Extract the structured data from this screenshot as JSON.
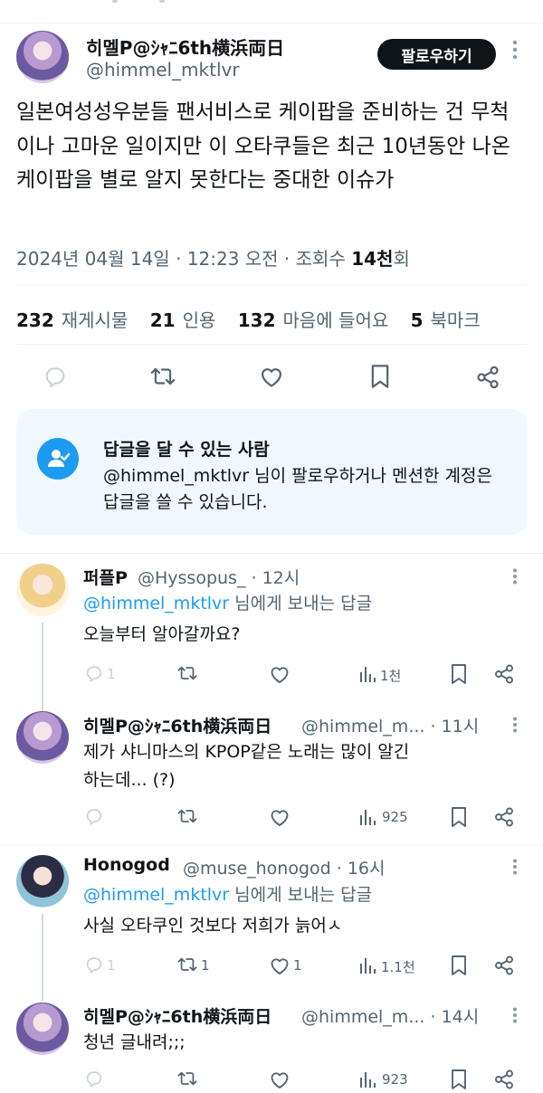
{
  "tweet": {
    "display_name": "히멜P@ｼｬﾆ6th横浜両日",
    "handle": "@himmel_mktlvr",
    "follow_label": "팔로우하기",
    "more_label": "⋮",
    "text": "일본여성성우분들 팬서비스로 케이팝을 준비하는 건 무척이나 고마운 일이지만 이 오타쿠들은 최근 10년동안 나온 케이팝을 별로 알지 못한다는 중대한 이슈가",
    "date": "2024년 04월 14일 · 12:23 오전 · 조회수 ",
    "views_value": "14천",
    "views_suffix": "회",
    "stats": {
      "retweets": "232",
      "retweets_label": "재게시물",
      "quotes": "21",
      "quotes_label": "인용",
      "likes": "132",
      "likes_label": "마음에 들어요",
      "bookmarks": "5",
      "bookmarks_label": "북마크"
    }
  },
  "reply_restriction": {
    "title": "답글을 달 수 있는 사람",
    "description": "@himmel_mktlvr 님이 팔로우하거나 멘션한 계정은 답글을 쓸 수 있습니다."
  },
  "replies": [
    {
      "display_name": "퍼플P",
      "handle_time": "@Hyssopus_ · 12시",
      "replying_mention": "@himmel_mktlvr",
      "replying_suffix": " 님에게 보내는 답글",
      "text": "오늘부터 알아갈까요?",
      "reply_count": "1",
      "retweet_count": "",
      "like_count": "",
      "view_count": "1천"
    },
    {
      "display_name": "히멜P@ｼｬﾆ6th横浜両日",
      "handle_time": "@himmel_m... · 11시",
      "text_line1": "제가 샤니마스의 KPOP같은 노래는 많이 알긴",
      "text_line2": "하는데... (?)",
      "reply_count": "",
      "retweet_count": "",
      "like_count": "",
      "view_count": "925"
    },
    {
      "display_name": "Honogod",
      "handle_time": "@muse_honogod · 16시",
      "replying_mention": "@himmel_mktlvr",
      "replying_suffix": " 님에게 보내는 답글",
      "text": "사실 오타쿠인 것보다 저희가 늙어ㅅ",
      "reply_count": "1",
      "retweet_count": "1",
      "like_count": "1",
      "view_count": "1.1천"
    },
    {
      "display_name": "히멜P@ｼｬﾆ6th横浜両日",
      "handle_time": "@himmel_m... · 14시",
      "text": "청년 글내려;;;",
      "reply_count": "",
      "retweet_count": "",
      "like_count": "",
      "view_count": "923"
    }
  ],
  "colors": {
    "accent": "#1d9bf0",
    "muted": "#536471",
    "text": "#0f1419",
    "reply_box_bg": "#eff8fe"
  },
  "icons": [
    "reply-icon",
    "retweet-icon",
    "like-icon",
    "bookmark-icon",
    "share-icon",
    "views-icon",
    "person-check-icon",
    "more-icon"
  ]
}
